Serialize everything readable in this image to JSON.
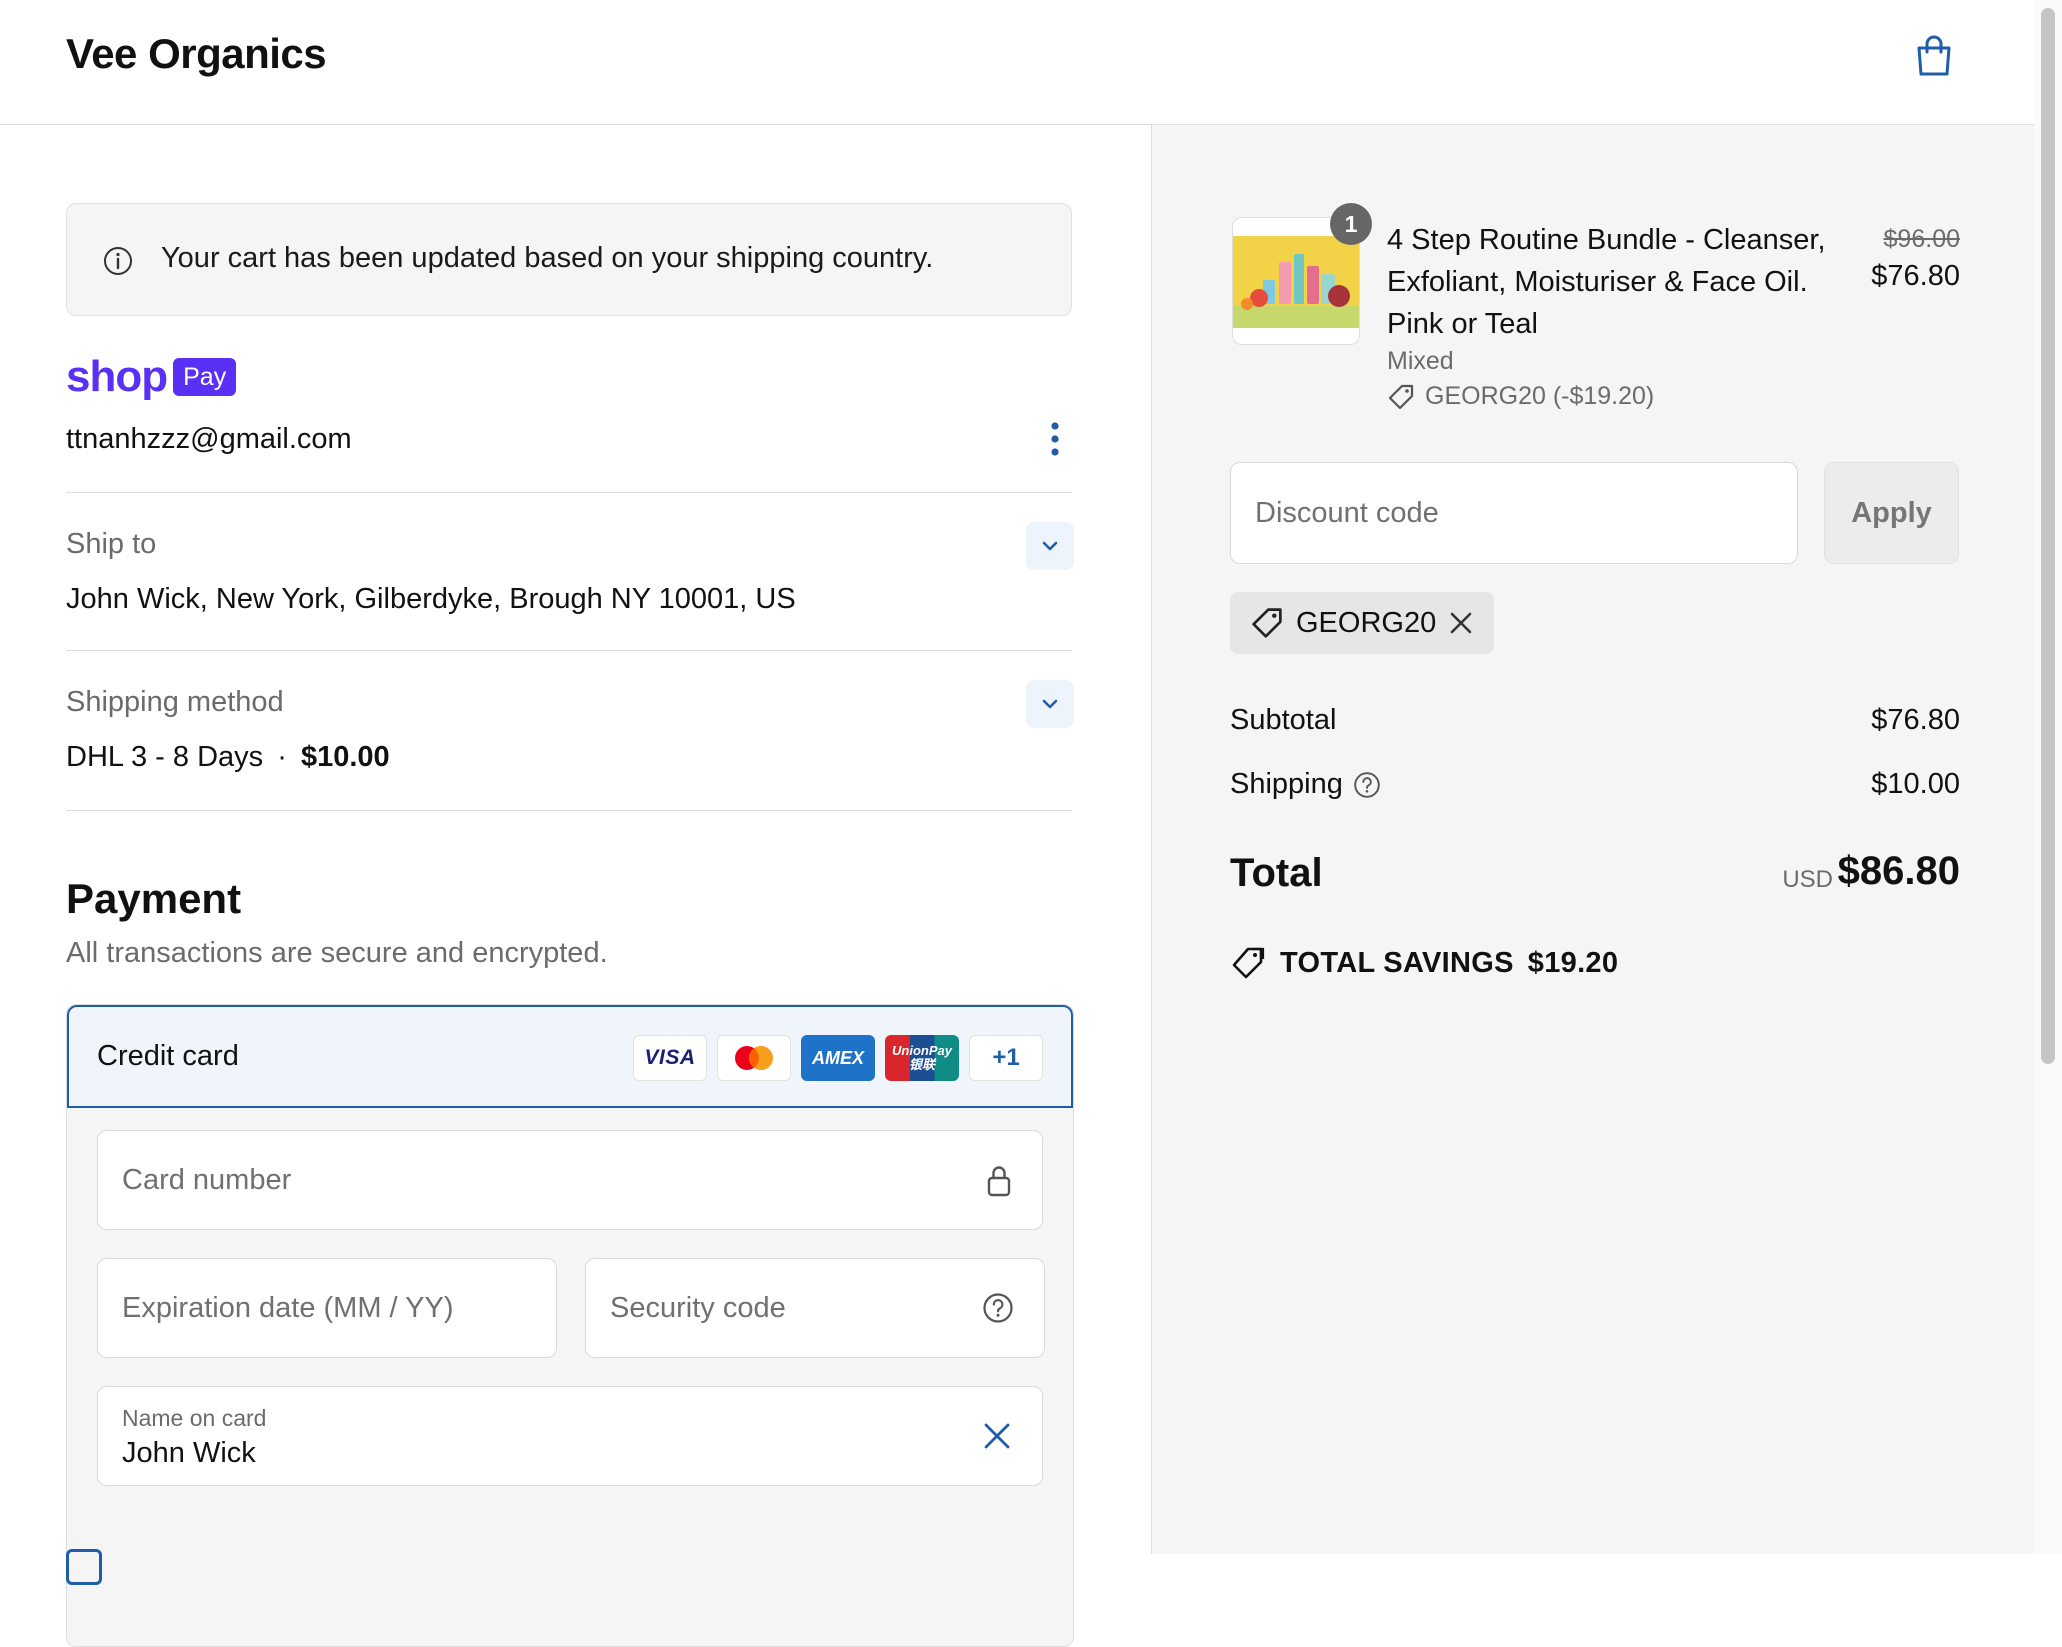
{
  "header": {
    "brand": "Vee Organics"
  },
  "notice": {
    "text": "Your cart has been updated based on your shipping country."
  },
  "contact": {
    "shop_word": "shop",
    "pay_word": "Pay",
    "email": "ttnanhzzz@gmail.com"
  },
  "ship_to": {
    "label": "Ship to",
    "value": "John Wick, New York, Gilberdyke, Brough NY 10001, US"
  },
  "shipping_method": {
    "label": "Shipping method",
    "value": "DHL 3 - 8 Days",
    "separator": "·",
    "price": "$10.00"
  },
  "payment": {
    "title": "Payment",
    "subtitle": "All transactions are secure and encrypted.",
    "method": "Credit card",
    "cards": {
      "visa": "VISA",
      "amex": "AMEX",
      "unionpay_top": "UnionPay",
      "unionpay_bottom": "银联",
      "more": "+1"
    },
    "card_number_placeholder": "Card number",
    "expiration_placeholder": "Expiration date (MM / YY)",
    "security_placeholder": "Security code",
    "name_label": "Name on card",
    "name_value": "John Wick"
  },
  "order": {
    "item": {
      "quantity": "1",
      "name": "4 Step Routine Bundle - Cleanser, Exfoliant, Moisturiser & Face Oil. Pink or Teal",
      "variant": "Mixed",
      "discount": "GEORG20 (-$19.20)",
      "original_price": "$96.00",
      "price": "$76.80"
    },
    "discount_placeholder": "Discount code",
    "apply_label": "Apply",
    "applied_code": "GEORG20",
    "subtotal_label": "Subtotal",
    "subtotal_value": "$76.80",
    "shipping_label": "Shipping",
    "shipping_value": "$10.00",
    "total_label": "Total",
    "currency": "USD",
    "total_value": "$86.80",
    "savings_label": "TOTAL SAVINGS",
    "savings_value": "$19.20"
  },
  "colors": {
    "accent": "#1f5da8",
    "shop_pay": "#5a31f4",
    "panel_bg": "#f5f5f5"
  },
  "icons": [
    "cart-icon",
    "info-icon",
    "kebab-icon",
    "chevron-down-icon",
    "lock-icon",
    "help-icon",
    "close-icon",
    "tag-icon"
  ]
}
